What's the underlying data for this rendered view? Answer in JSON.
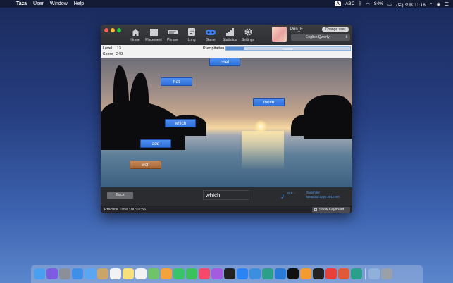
{
  "menubar": {
    "app_name": "Taza",
    "items": [
      "User",
      "Window",
      "Help"
    ],
    "input_source": "A",
    "input_label": "ABC",
    "battery": "84%",
    "clock": "(토) 오후 11:18"
  },
  "toolbar": {
    "tools": [
      {
        "label": "Home",
        "icon": "home-icon"
      },
      {
        "label": "Placement",
        "icon": "placement-icon"
      },
      {
        "label": "Phrase",
        "icon": "phrase-icon"
      },
      {
        "label": "Long",
        "icon": "long-icon"
      },
      {
        "label": "Game",
        "icon": "game-icon"
      },
      {
        "label": "Statistics",
        "icon": "statistics-icon"
      },
      {
        "label": "Settings",
        "icon": "settings-icon"
      }
    ],
    "user_name": "Prin_E",
    "change_user_label": "Change user",
    "keyboard_layout": "English Qwerty"
  },
  "status": {
    "level_label": "Level",
    "level_value": "13",
    "score_label": "Score",
    "score_value": "240",
    "precipitation_label": "Precipitation",
    "precipitation_value": 0.14,
    "precipitation_text": "14/100"
  },
  "game": {
    "words": [
      {
        "text": "chef",
        "state": "falling"
      },
      {
        "text": "hat",
        "state": "falling"
      },
      {
        "text": "move",
        "state": "falling"
      },
      {
        "text": "which",
        "state": "falling"
      },
      {
        "text": "add",
        "state": "falling"
      },
      {
        "text": "wolf",
        "state": "hit"
      }
    ]
  },
  "bottom": {
    "back_label": "Back",
    "input_value": "which",
    "music_artist": "G.F. -",
    "music_title": "Sunshine",
    "music_album": "Beautiful days 2010 ver."
  },
  "footer": {
    "practice_time_label": "Practice Time :",
    "practice_time_value": "00:02:56",
    "show_keyboard_label": "Show Keyboard"
  },
  "colors": {
    "word_blue": "#2f6fd8",
    "word_hit": "#a56533",
    "music_blue": "#5b9cf0"
  },
  "dock": {
    "icons": [
      "finder-icon",
      "siri-icon",
      "launchpad-icon",
      "safari-icon",
      "mail-icon",
      "contacts-icon",
      "calendar-icon",
      "notes-icon",
      "reminders-icon",
      "maps-icon",
      "photos-icon",
      "messages-icon",
      "facetime-icon",
      "music-icon",
      "podcasts-icon",
      "tv-icon",
      "appstore-icon",
      "xcode-icon",
      "taza-icon",
      "vscode-icon",
      "inkscape-icon",
      "books-icon",
      "epic-games-icon",
      "creative-cloud-icon",
      "git-icon",
      "vpn-icon",
      "downloads-icon",
      "trash-icon"
    ]
  }
}
